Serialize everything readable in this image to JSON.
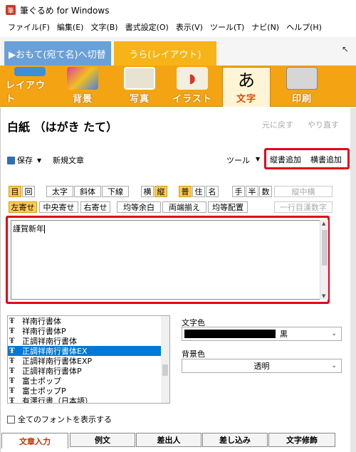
{
  "window": {
    "title": "筆ぐるめ for Windows",
    "app_icon": "fude-gurume-app-icon"
  },
  "menu": [
    "ファイル(F)",
    "編集(E)",
    "文字(B)",
    "書式設定(O)",
    "表示(V)",
    "ツール(T)",
    "ナビ(N)",
    "ヘルプ(H)"
  ],
  "mode_tabs": {
    "front": "▶おもて(宛て名)へ切替",
    "back": "うら(レイアウト)"
  },
  "toolbar": {
    "items": [
      {
        "label": "レイアウト",
        "icon": "layout-icon"
      },
      {
        "label": "背景",
        "icon": "background-icon"
      },
      {
        "label": "写真",
        "icon": "photo-icon"
      },
      {
        "label": "イラスト",
        "icon": "illustration-icon"
      },
      {
        "label": "文字",
        "icon": "text-icon",
        "active": true
      },
      {
        "label": "印刷",
        "icon": "printer-icon"
      }
    ]
  },
  "panel": {
    "title": "白紙 （はがき たて）",
    "undo": "元に戻す",
    "redo": "やり直す",
    "save": "保存",
    "new_doc": "新規文章",
    "tool_menu": "ツール",
    "add_vertical": "縦書追加",
    "add_horizontal": "横書追加"
  },
  "format_row1": [
    "目",
    "回",
    "太字",
    "斜体",
    "下線",
    "横",
    "縦",
    "普",
    "住",
    "名",
    "手",
    "半",
    "数",
    "縦中横"
  ],
  "format_row2": [
    "左寄せ",
    "中央寄せ",
    "右寄せ",
    "均等余白",
    "両端揃え",
    "均等配置",
    "一行目漢数字"
  ],
  "text_content": "謹賀新年",
  "fonts": [
    "祥南行書体",
    "祥南行書体P",
    "正調祥南行書体",
    "正調祥南行書体EX",
    "正調祥南行書体EXP",
    "正調祥南行書体P",
    "富士ポップ",
    "富士ポップP",
    "有澤行書（日本語）"
  ],
  "selected_font_index": 3,
  "show_all_fonts": "全てのフォントを表示する",
  "color": {
    "label": "文字色",
    "value": "黒",
    "swatch": "#000000"
  },
  "bg_color": {
    "label": "背景色",
    "value": "透明"
  },
  "bottom_tabs": [
    "文章入力",
    "例文",
    "差出人",
    "差し込み",
    "文字修飾"
  ],
  "colors": {
    "accent_orange": "#f4a412",
    "tab_blue": "#6aa0d8",
    "highlight_red": "#e0001a",
    "selection_blue": "#0078d7"
  }
}
